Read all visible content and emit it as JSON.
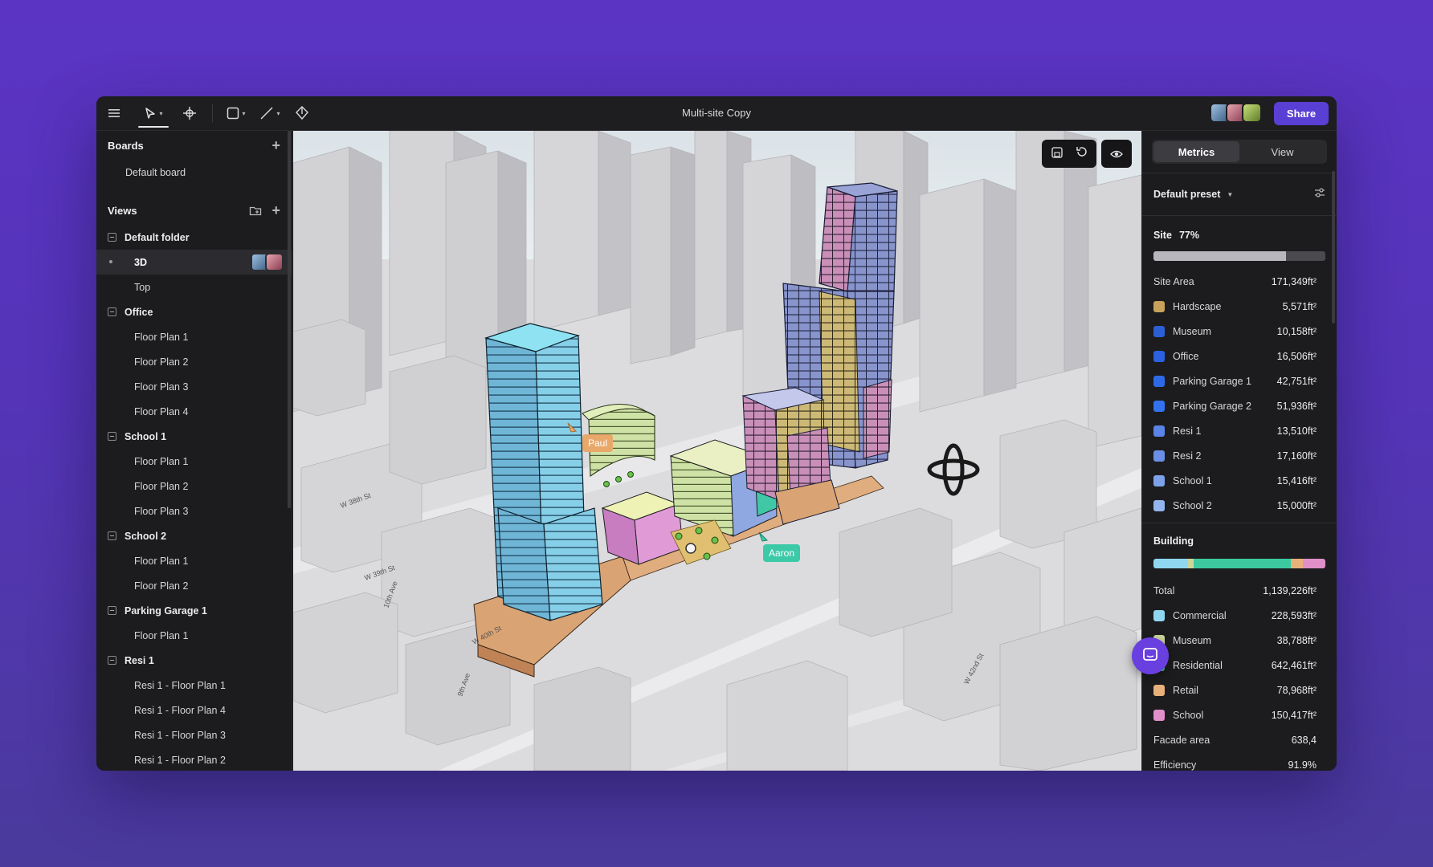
{
  "app": {
    "title": "Multi-site Copy",
    "share_label": "Share"
  },
  "toolbar": {
    "tools": [
      "menu-icon",
      "select-icon",
      "pan-icon",
      "rectangle-icon",
      "line-icon",
      "pen-icon"
    ],
    "collaborator_colors": [
      "#6a8fb8",
      "#b86a7a",
      "#8fb86a"
    ]
  },
  "sidebar": {
    "boards_title": "Boards",
    "boards": [
      "Default board"
    ],
    "views_title": "Views",
    "folders": [
      {
        "name": "Default folder",
        "items": [
          "3D",
          "Top"
        ]
      },
      {
        "name": "Office",
        "items": [
          "Floor Plan 1",
          "Floor Plan 2",
          "Floor Plan 3",
          "Floor Plan 4"
        ]
      },
      {
        "name": "School 1",
        "items": [
          "Floor Plan 1",
          "Floor Plan 2",
          "Floor Plan 3"
        ]
      },
      {
        "name": "School 2",
        "items": [
          "Floor Plan 1",
          "Floor Plan 2"
        ]
      },
      {
        "name": "Parking Garage 1",
        "items": [
          "Floor Plan 1"
        ]
      },
      {
        "name": "Resi 1",
        "items": [
          "Resi 1 - Floor Plan 1",
          "Resi 1 - Floor Plan 4",
          "Resi 1 - Floor Plan 3",
          "Resi 1 - Floor Plan 2"
        ]
      }
    ],
    "selected_view": "3D"
  },
  "viewport": {
    "cursors": [
      {
        "name": "Paul",
        "color": "#e8a86a"
      },
      {
        "name": "Aaron",
        "color": "#3cc9a8"
      }
    ],
    "street_labels": [
      "W 38th St",
      "W 39th St",
      "10th Ave",
      "9th Ave",
      "W 40th St",
      "W 42nd St"
    ]
  },
  "panel": {
    "tabs": [
      "Metrics",
      "View"
    ],
    "active_tab": "Metrics",
    "preset": "Default preset",
    "site": {
      "title": "Site",
      "percent_label": "77%",
      "percent_value": 0.77,
      "area_label": "Site Area",
      "area_value": "171,349ft²",
      "rows": [
        {
          "label": "Hardscape",
          "value": "5,571ft²",
          "color": "#c8a25a"
        },
        {
          "label": "Museum",
          "value": "10,158ft²",
          "color": "#2c5fd6"
        },
        {
          "label": "Office",
          "value": "16,506ft²",
          "color": "#2a62e0"
        },
        {
          "label": "Parking Garage 1",
          "value": "42,751ft²",
          "color": "#2e6ae8"
        },
        {
          "label": "Parking Garage 2",
          "value": "51,936ft²",
          "color": "#3272ee"
        },
        {
          "label": "Resi 1",
          "value": "13,510ft²",
          "color": "#5b84e8"
        },
        {
          "label": "Resi 2",
          "value": "17,160ft²",
          "color": "#6a8fe6"
        },
        {
          "label": "School 1",
          "value": "15,416ft²",
          "color": "#7ea2ea"
        },
        {
          "label": "School 2",
          "value": "15,000ft²",
          "color": "#93b4ee"
        }
      ]
    },
    "building": {
      "title": "Building",
      "total_label": "Total",
      "total_value": "1,139,226ft²",
      "rows": [
        {
          "label": "Commercial",
          "value": "228,593ft²",
          "color": "#8fd7f0"
        },
        {
          "label": "Museum",
          "value": "38,788ft²",
          "color": "#cbd69a"
        },
        {
          "label": "Residential",
          "value": "642,461ft²",
          "color": "#3cc9a0"
        },
        {
          "label": "Retail",
          "value": "78,968ft²",
          "color": "#e8b07a"
        },
        {
          "label": "School",
          "value": "150,417ft²",
          "color": "#e08fc8"
        }
      ],
      "facade_label": "Facade area",
      "facade_value": "638,4",
      "efficiency_label": "Efficiency",
      "efficiency_value": "91.9%"
    }
  }
}
